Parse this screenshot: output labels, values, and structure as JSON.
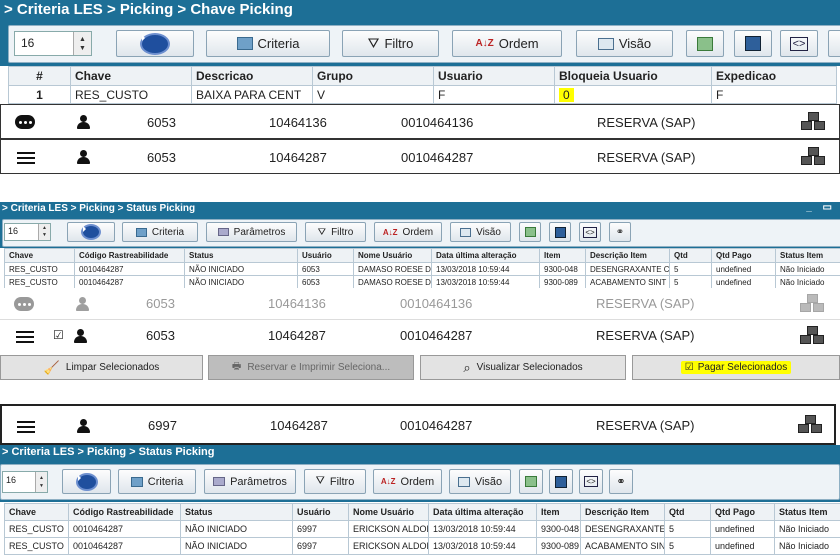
{
  "panel1": {
    "title": "> Criteria LES > Picking > Chave Picking",
    "spin_value": "16",
    "buttons": {
      "criteria": "Criteria",
      "filtro": "Filtro",
      "ordem": "Ordem",
      "visao": "Visão"
    },
    "columns": [
      "#",
      "Chave",
      "Descricao",
      "Grupo",
      "Usuario",
      "Bloqueia Usuario",
      "Expedicao"
    ],
    "row": [
      "1",
      "RES_CUSTO",
      "BAIXA PARA CENT",
      "V",
      "F",
      "0",
      "F"
    ]
  },
  "list_row1": {
    "a": "6053",
    "b": "10464136",
    "c": "0010464136",
    "d": "RESERVA (SAP)"
  },
  "list_row2": {
    "a": "6053",
    "b": "10464287",
    "c": "0010464287",
    "d": "RESERVA (SAP)"
  },
  "panel2": {
    "title": "> Criteria LES > Picking > Status Picking",
    "spin_value": "16",
    "buttons": {
      "criteria": "Criteria",
      "parametros": "Parâmetros",
      "filtro": "Filtro",
      "ordem": "Ordem",
      "visao": "Visão"
    },
    "columns": [
      "Chave",
      "Código Rastreabilidade",
      "Status",
      "Usuário",
      "Nome Usuário",
      "Data última alteração",
      "Item",
      "Descrição Item",
      "Qtd",
      "Qtd Pago",
      "Status Item"
    ],
    "rows": [
      [
        "RES_CUSTO",
        "0010464287",
        "NÃO INICIADO",
        "6053",
        "DAMASO ROESE D",
        "13/03/2018 10:59:44",
        "9300-048",
        "DESENGRAXANTE C",
        "5",
        "undefined",
        "Não Iniciado"
      ],
      [
        "RES_CUSTO",
        "0010464287",
        "NÃO INICIADO",
        "6053",
        "DAMASO ROESE D",
        "13/03/2018 10:59:44",
        "9300-089",
        "ACABAMENTO SINT",
        "5",
        "undefined",
        "Não Iniciado"
      ]
    ]
  },
  "list_row3": {
    "a": "6053",
    "b": "10464136",
    "c": "0010464136",
    "d": "RESERVA (SAP)"
  },
  "list_row4": {
    "a": "6053",
    "b": "10464287",
    "c": "0010464287",
    "d": "RESERVA (SAP)"
  },
  "actions": {
    "limpar": "Limpar Selecionados",
    "reservar": "Reservar e Imprimir Seleciona...",
    "visualizar": "Visualizar Selecionados",
    "pagar": "Pagar Selecionados"
  },
  "list_row5": {
    "a": "6997",
    "b": "10464287",
    "c": "0010464287",
    "d": "RESERVA (SAP)"
  },
  "panel3": {
    "title": "> Criteria LES > Picking > Status Picking",
    "spin_value": "16",
    "buttons": {
      "criteria": "Criteria",
      "parametros": "Parâmetros",
      "filtro": "Filtro",
      "ordem": "Ordem",
      "visao": "Visão"
    },
    "columns": [
      "Chave",
      "Código Rastreabilidade",
      "Status",
      "Usuário",
      "Nome Usuário",
      "Data última alteração",
      "Item",
      "Descrição Item",
      "Qtd",
      "Qtd Pago",
      "Status Item"
    ],
    "rows": [
      [
        "RES_CUSTO",
        "0010464287",
        "NÃO INICIADO",
        "6997",
        "ERICKSON ALDOR",
        "13/03/2018 10:59:44",
        "9300-048",
        "DESENGRAXANTE C",
        "5",
        "undefined",
        "Não Iniciado"
      ],
      [
        "RES_CUSTO",
        "0010464287",
        "NÃO INICIADO",
        "6997",
        "ERICKSON ALDOR",
        "13/03/2018 10:59:44",
        "9300-089",
        "ACABAMENTO SINT",
        "5",
        "undefined",
        "Não Iniciado"
      ]
    ]
  },
  "colors": {
    "titlebar": "#1d6f96",
    "highlight": "#ffff00"
  },
  "icons": [
    "play-icon",
    "criteria-icon",
    "filter-icon",
    "sort-icon",
    "view-icon",
    "export-icon",
    "save-icon",
    "code-icon",
    "menu-icon",
    "person-icon",
    "more-icon",
    "boxes-icon",
    "broom-icon",
    "printer-icon",
    "search-icon",
    "checkbox-icon"
  ]
}
